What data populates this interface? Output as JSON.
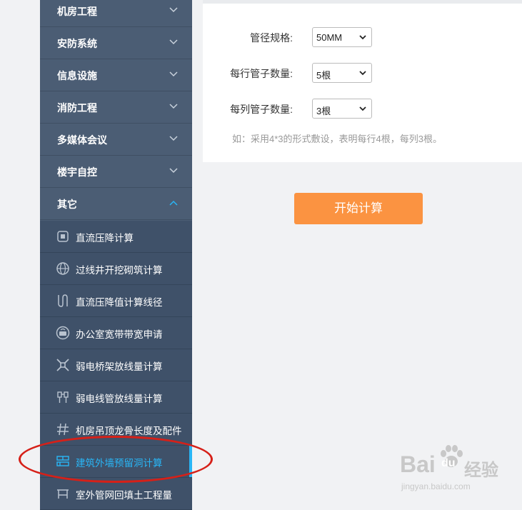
{
  "sidebar": {
    "categories": [
      {
        "label": "机房工程",
        "expanded": false
      },
      {
        "label": "安防系统",
        "expanded": false
      },
      {
        "label": "信息设施",
        "expanded": false
      },
      {
        "label": "消防工程",
        "expanded": false
      },
      {
        "label": "多媒体会议",
        "expanded": false
      },
      {
        "label": "楼宇自控",
        "expanded": false
      },
      {
        "label": "其它",
        "expanded": true
      }
    ],
    "sub_items": [
      {
        "label": "直流压降计算",
        "icon": "chip-icon"
      },
      {
        "label": "过线井开挖砌筑计算",
        "icon": "globe-icon"
      },
      {
        "label": "直流压降值计算线径",
        "icon": "cable-icon"
      },
      {
        "label": "办公室宽带带宽申请",
        "icon": "router-icon"
      },
      {
        "label": "弱电桥架放线量计算",
        "icon": "tray-icon"
      },
      {
        "label": "弱电线管放线量计算",
        "icon": "conduit-icon"
      },
      {
        "label": "机房吊顶龙骨长度及配件",
        "icon": "grid-icon"
      },
      {
        "label": "建筑外墙预留洞计算",
        "icon": "wall-hole-icon",
        "active": true
      },
      {
        "label": "室外管网回填土工程量",
        "icon": "trench-icon"
      }
    ]
  },
  "form": {
    "pipe_spec_label": "管径规格:",
    "pipe_spec_value": "50MM",
    "per_row_label": "每行管子数量:",
    "per_row_value": "5根",
    "per_col_label": "每列管子数量:",
    "per_col_value": "3根",
    "hint": "如：采用4*3的形式敷设，表明每行4根，每列3根。"
  },
  "calc_button": "开始计算",
  "watermark": {
    "brand": "Bai",
    "brand2": "du",
    "cn": "经验",
    "url": "jingyan.baidu.com"
  },
  "colors": {
    "sidebar": "#4b5d74",
    "sub_sidebar": "#3f5169",
    "accent": "#29b6f6",
    "button": "#fb9341",
    "annotation": "#d62018"
  }
}
